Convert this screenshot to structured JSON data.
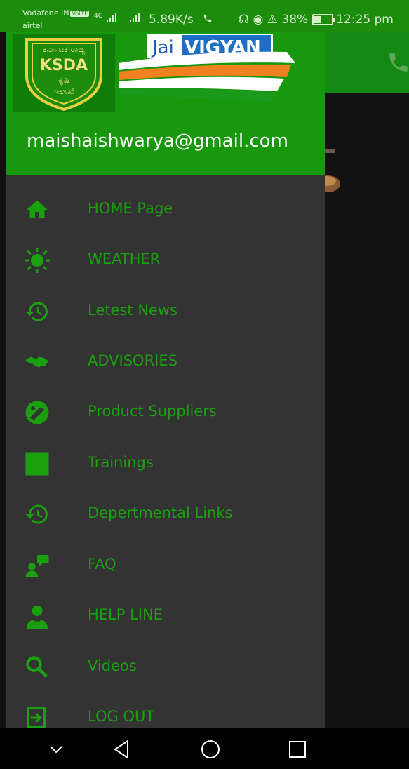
{
  "status_bar": {
    "carrier_1": "Vodafone IN",
    "volte": "VoLTE",
    "carrier_2": "airtel",
    "network": "4G",
    "speed": "5.89K/s",
    "battery": "38%",
    "battery_level": 0.38,
    "time": "12:25 pm"
  },
  "header": {
    "logo_ksda_text": "KSDA",
    "logo_jai_text_1": "Jai",
    "logo_jai_text_2": "VIGYAN",
    "email": "maishaishwarya@gmail.com"
  },
  "menu": {
    "items": [
      {
        "label": "HOME Page",
        "icon": "home-icon"
      },
      {
        "label": "WEATHER",
        "icon": "sun-icon"
      },
      {
        "label": "Letest News",
        "icon": "history-icon"
      },
      {
        "label": "ADVISORIES",
        "icon": "handshake-icon"
      },
      {
        "label": "Product Suppliers",
        "icon": "tractor-badge-icon"
      },
      {
        "label": "Trainings",
        "icon": "square-icon"
      },
      {
        "label": "Depertmental Links",
        "icon": "history-icon"
      },
      {
        "label": "FAQ",
        "icon": "faq-icon"
      },
      {
        "label": "HELP LINE",
        "icon": "support-person-icon"
      },
      {
        "label": "Videos",
        "icon": "search-icon"
      },
      {
        "label": "LOG OUT",
        "icon": "logout-icon"
      }
    ]
  },
  "colors": {
    "accent_green": "#18980c",
    "menu_text": "#1aa00f",
    "drawer_bg": "#333333"
  }
}
